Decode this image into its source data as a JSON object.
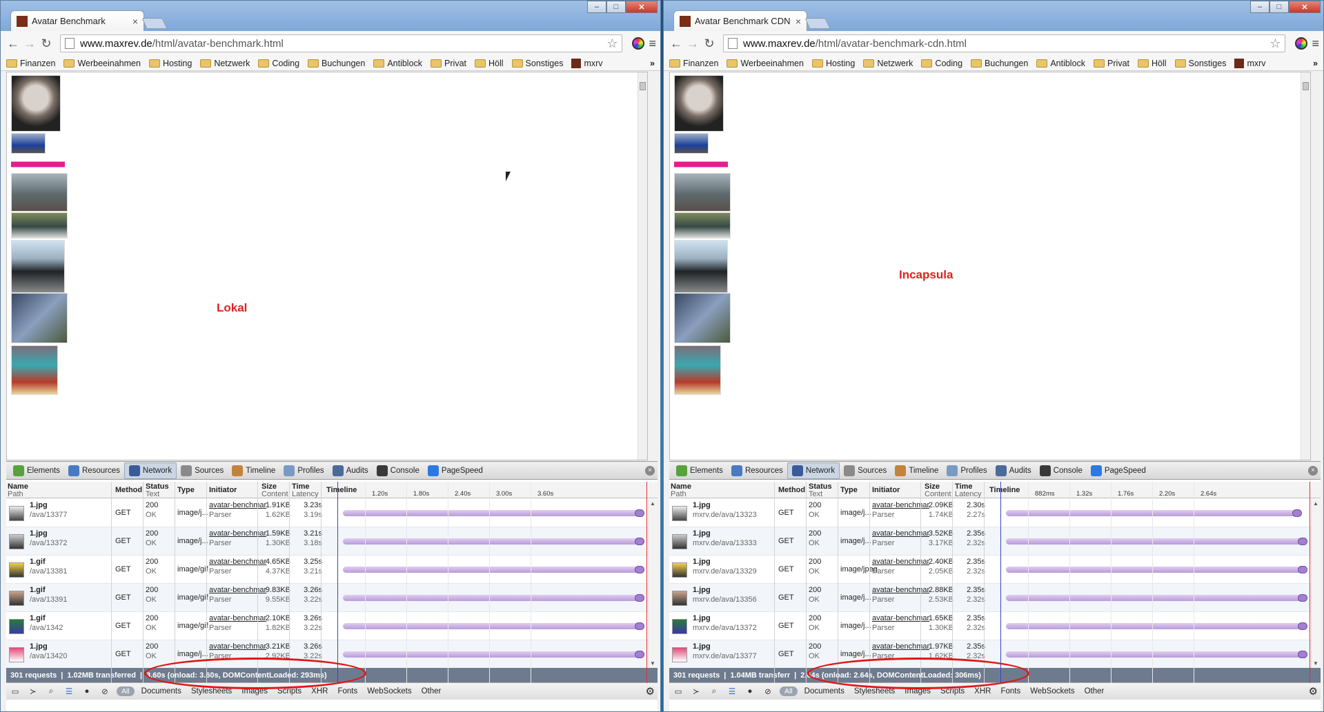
{
  "bookmarks": [
    "Finanzen",
    "Werbeeinahmen",
    "Hosting",
    "Netzwerk",
    "Coding",
    "Buchungen",
    "Antiblock",
    "Privat",
    "Höll",
    "Sonstiges",
    "mxrv"
  ],
  "devtabs": [
    "Elements",
    "Resources",
    "Network",
    "Sources",
    "Timeline",
    "Profiles",
    "Audits",
    "Console",
    "PageSpeed"
  ],
  "headers": {
    "name": "Name",
    "path": "Path",
    "method": "Method",
    "status": "Status",
    "status_sub": "Text",
    "type": "Type",
    "initiator": "Initiator",
    "size": "Size",
    "size_sub": "Content",
    "time": "Time",
    "time_sub": "Latency",
    "timeline": "Timeline"
  },
  "filters": [
    "All",
    "Documents",
    "Stylesheets",
    "Images",
    "Scripts",
    "XHR",
    "Fonts",
    "WebSockets",
    "Other"
  ],
  "left": {
    "tab_title": "Avatar Benchmark",
    "url_domain": "www.maxrev.de",
    "url_path": "/html/avatar-benchmark.html",
    "label": "Lokal",
    "ticks": [
      "1.20s",
      "1.80s",
      "2.40s",
      "3.00s",
      "3.60s"
    ],
    "rows": [
      {
        "name": "1.jpg",
        "path": "/ava/13377",
        "method": "GET",
        "status": "200",
        "status_text": "OK",
        "type": "image/j...",
        "initiator": "avatar-benchmar",
        "init_sub": "Parser",
        "size": "1.91KB",
        "content": "1.62KB",
        "time": "3.23s",
        "latency": "3.19s"
      },
      {
        "name": "1.jpg",
        "path": "/ava/13372",
        "method": "GET",
        "status": "200",
        "status_text": "OK",
        "type": "image/j...",
        "initiator": "avatar-benchmar",
        "init_sub": "Parser",
        "size": "1.59KB",
        "content": "1.30KB",
        "time": "3.21s",
        "latency": "3.18s"
      },
      {
        "name": "1.gif",
        "path": "/ava/13381",
        "method": "GET",
        "status": "200",
        "status_text": "OK",
        "type": "image/gif",
        "initiator": "avatar-benchmar",
        "init_sub": "Parser",
        "size": "4.65KB",
        "content": "4.37KB",
        "time": "3.25s",
        "latency": "3.21s"
      },
      {
        "name": "1.gif",
        "path": "/ava/13391",
        "method": "GET",
        "status": "200",
        "status_text": "OK",
        "type": "image/gif",
        "initiator": "avatar-benchmar",
        "init_sub": "Parser",
        "size": "9.83KB",
        "content": "9.55KB",
        "time": "3.26s",
        "latency": "3.22s"
      },
      {
        "name": "1.gif",
        "path": "/ava/1342",
        "method": "GET",
        "status": "200",
        "status_text": "OK",
        "type": "image/gif",
        "initiator": "avatar-benchmar",
        "init_sub": "Parser",
        "size": "2.10KB",
        "content": "1.82KB",
        "time": "3.26s",
        "latency": "3.22s"
      },
      {
        "name": "1.jpg",
        "path": "/ava/13420",
        "method": "GET",
        "status": "200",
        "status_text": "OK",
        "type": "image/j...",
        "initiator": "avatar-benchmar",
        "init_sub": "Parser",
        "size": "3.21KB",
        "content": "2.92KB",
        "time": "3.26s",
        "latency": "3.22s"
      }
    ],
    "summary_requests": "301 requests",
    "summary_transferred": "1.02MB transferred",
    "summary_timing": "3.60s (onload: 3.60s, DOMContentLoaded: 293ms)"
  },
  "right": {
    "tab_title": "Avatar Benchmark CDN",
    "url_domain": "www.maxrev.de",
    "url_path": "/html/avatar-benchmark-cdn.html",
    "label": "Incapsula",
    "ticks": [
      "882ms",
      "1.32s",
      "1.76s",
      "2.20s",
      "2.64s"
    ],
    "rows": [
      {
        "name": "1.jpg",
        "path": "mxrv.de/ava/13323",
        "method": "GET",
        "status": "200",
        "status_text": "OK",
        "type": "image/j...",
        "initiator": "avatar-benchmar",
        "init_sub": "Parser",
        "size": "2.09KB",
        "content": "1.74KB",
        "time": "2.30s",
        "latency": "2.27s"
      },
      {
        "name": "1.jpg",
        "path": "mxrv.de/ava/13333",
        "method": "GET",
        "status": "200",
        "status_text": "OK",
        "type": "image/j...",
        "initiator": "avatar-benchmar",
        "init_sub": "Parser",
        "size": "3.52KB",
        "content": "3.17KB",
        "time": "2.35s",
        "latency": "2.32s"
      },
      {
        "name": "1.jpg",
        "path": "mxrv.de/ava/13329",
        "method": "GET",
        "status": "200",
        "status_text": "OK",
        "type": "image/jpeg",
        "initiator": "avatar-benchmar",
        "init_sub": "Parser",
        "size": "2.40KB",
        "content": "2.05KB",
        "time": "2.35s",
        "latency": "2.32s"
      },
      {
        "name": "1.jpg",
        "path": "mxrv.de/ava/13356",
        "method": "GET",
        "status": "200",
        "status_text": "OK",
        "type": "image/j...",
        "initiator": "avatar-benchmar",
        "init_sub": "Parser",
        "size": "2.88KB",
        "content": "2.53KB",
        "time": "2.35s",
        "latency": "2.32s"
      },
      {
        "name": "1.jpg",
        "path": "mxrv.de/ava/13372",
        "method": "GET",
        "status": "200",
        "status_text": "OK",
        "type": "image/j...",
        "initiator": "avatar-benchmar",
        "init_sub": "Parser",
        "size": "1.65KB",
        "content": "1.30KB",
        "time": "2.35s",
        "latency": "2.32s"
      },
      {
        "name": "1.jpg",
        "path": "mxrv.de/ava/13377",
        "method": "GET",
        "status": "200",
        "status_text": "OK",
        "type": "image/j...",
        "initiator": "avatar-benchmar",
        "init_sub": "Parser",
        "size": "1.97KB",
        "content": "1.62KB",
        "time": "2.35s",
        "latency": "2.32s"
      }
    ],
    "summary_requests": "301 requests",
    "summary_transferred": "1.04MB transferr",
    "summary_timing": "2.64s (onload: 2.64s, DOMContentLoaded: 306ms)"
  },
  "colors": {
    "accent_red": "#e21f1f",
    "bar_purple": "#b89bd8",
    "summary_bg": "#6e7b8e"
  }
}
